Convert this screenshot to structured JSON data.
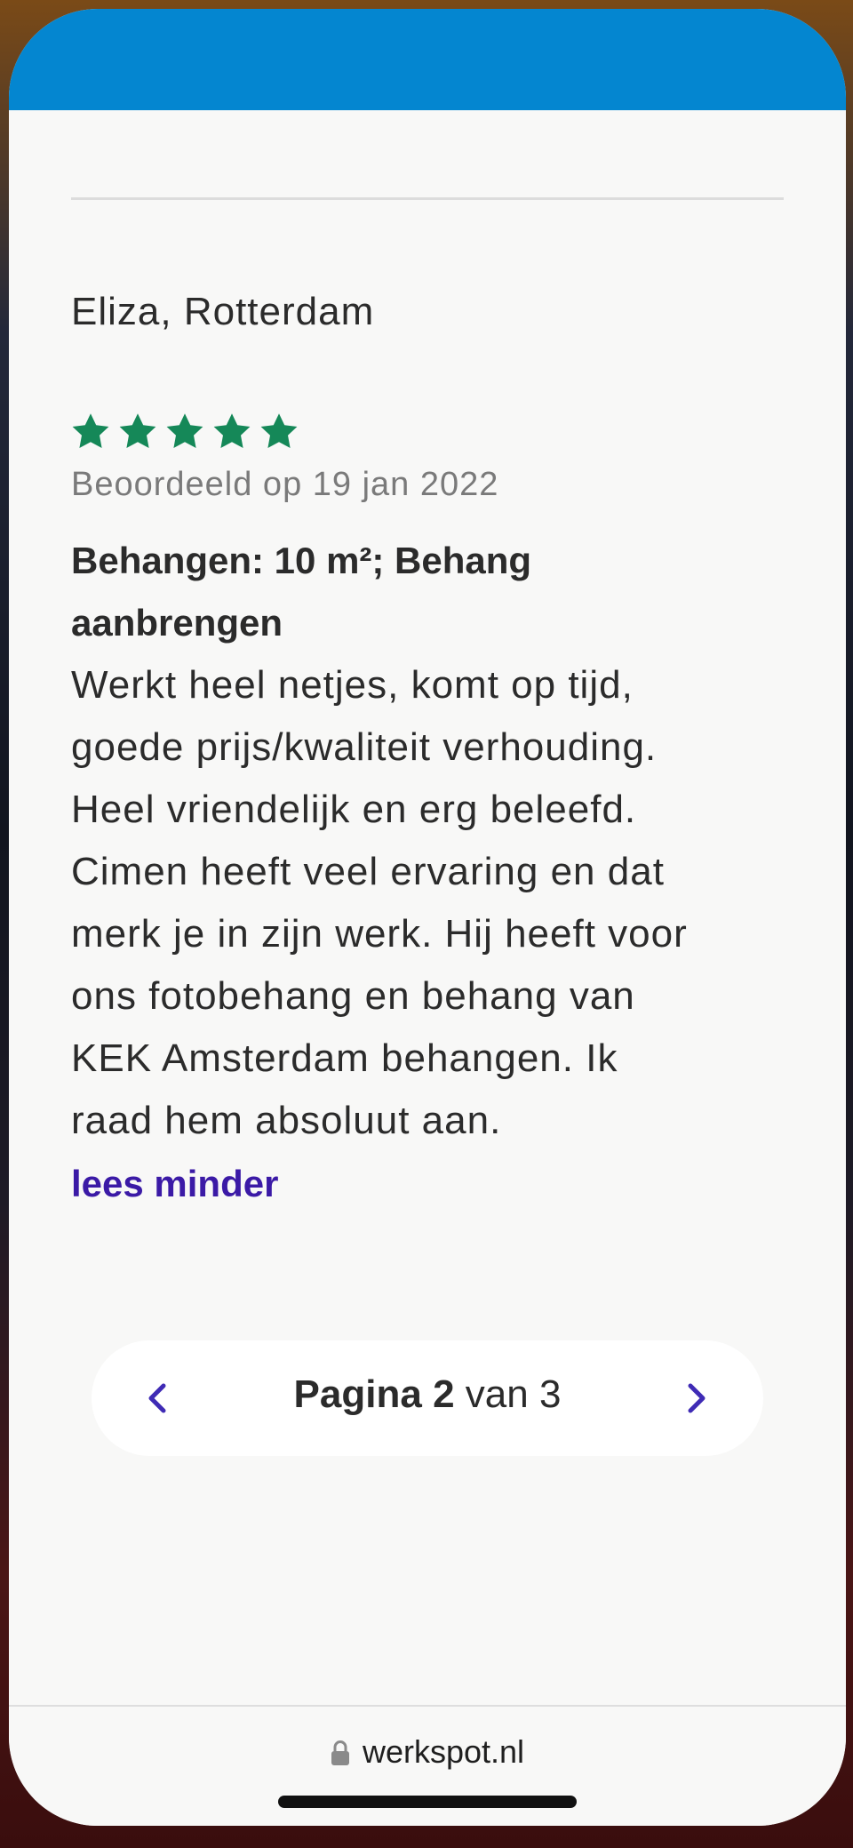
{
  "review": {
    "reviewer": "Eliza, Rotterdam",
    "rating": 5,
    "max_rating": 5,
    "rating_color": "#158858",
    "date_label": "Beoordeeld op 19 jan 2022",
    "title_lines": [
      "Behangen: 10 m²; Behang",
      "aanbrengen"
    ],
    "body_lines": [
      "Werkt heel netjes, komt op tijd,",
      "goede prijs/kwaliteit verhouding.",
      "Heel vriendelijk en erg beleefd.",
      "Cimen heeft veel ervaring en dat",
      "merk je in zijn werk. Hij heeft voor",
      "ons fotobehang en behang van",
      "KEK Amsterdam behangen. Ik",
      "raad hem absoluut aan."
    ],
    "toggle_label": "lees minder"
  },
  "pagination": {
    "page_word": "Pagina",
    "current_page": "2",
    "of_word": "van",
    "total_pages": "3",
    "prev_icon": "chevron-left-icon",
    "next_icon": "chevron-right-icon",
    "accent_color": "#3f2bb5"
  },
  "browser": {
    "url": "werkspot.nl",
    "lock_icon": "lock-icon"
  },
  "colors": {
    "header": "#0486d0",
    "link": "#3b1aa6",
    "background": "#f8f8f7"
  }
}
